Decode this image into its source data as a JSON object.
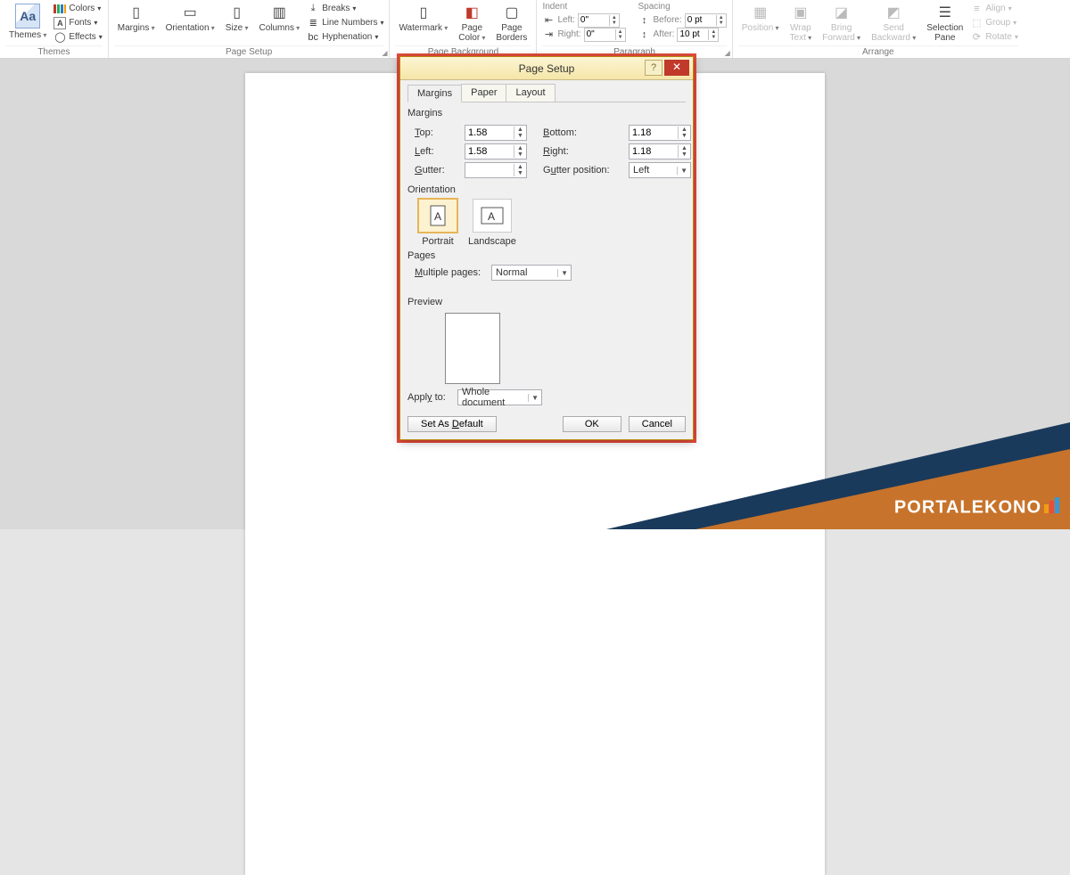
{
  "ribbon": {
    "themes": {
      "label": "Themes",
      "btn": "Themes",
      "colors": "Colors",
      "fonts": "Fonts",
      "effects": "Effects"
    },
    "page_setup": {
      "label": "Page Setup",
      "margins": "Margins",
      "orientation": "Orientation",
      "size": "Size",
      "columns": "Columns",
      "breaks": "Breaks",
      "line_numbers": "Line Numbers",
      "hyphenation": "Hyphenation"
    },
    "page_background": {
      "label": "Page Background",
      "watermark": "Watermark",
      "page_color": "Page\nColor",
      "page_borders": "Page\nBorders"
    },
    "paragraph": {
      "label": "Paragraph",
      "indent": "Indent",
      "left": "Left:",
      "right": "Right:",
      "left_val": "0\"",
      "right_val": "0\"",
      "spacing": "Spacing",
      "before": "Before:",
      "after": "After:",
      "before_val": "0 pt",
      "after_val": "10 pt"
    },
    "arrange": {
      "label": "Arrange",
      "position": "Position",
      "wrap_text": "Wrap\nText",
      "bring_forward": "Bring\nForward",
      "send_backward": "Send\nBackward",
      "selection_pane": "Selection\nPane",
      "align": "Align",
      "group": "Group",
      "rotate": "Rotate"
    }
  },
  "dialog": {
    "title": "Page Setup",
    "tabs": {
      "margins": "Margins",
      "paper": "Paper",
      "layout": "Layout"
    },
    "margins_section": "Margins",
    "top": "Top:",
    "top_val": "1.58",
    "bottom": "Bottom:",
    "bottom_val": "1.18",
    "left": "Left:",
    "left_val": "1.58",
    "right": "Right:",
    "right_val": "1.18",
    "gutter": "Gutter:",
    "gutter_val": "",
    "gutter_pos": "Gutter position:",
    "gutter_pos_val": "Left",
    "orientation_section": "Orientation",
    "portrait": "Portrait",
    "landscape": "Landscape",
    "pages_section": "Pages",
    "multiple_pages": "Multiple pages:",
    "multiple_pages_val": "Normal",
    "preview_section": "Preview",
    "apply_to": "Apply to:",
    "apply_to_val": "Whole document",
    "set_default": "Set As Default",
    "ok": "OK",
    "cancel": "Cancel"
  },
  "watermark": "PORTALEKONO"
}
